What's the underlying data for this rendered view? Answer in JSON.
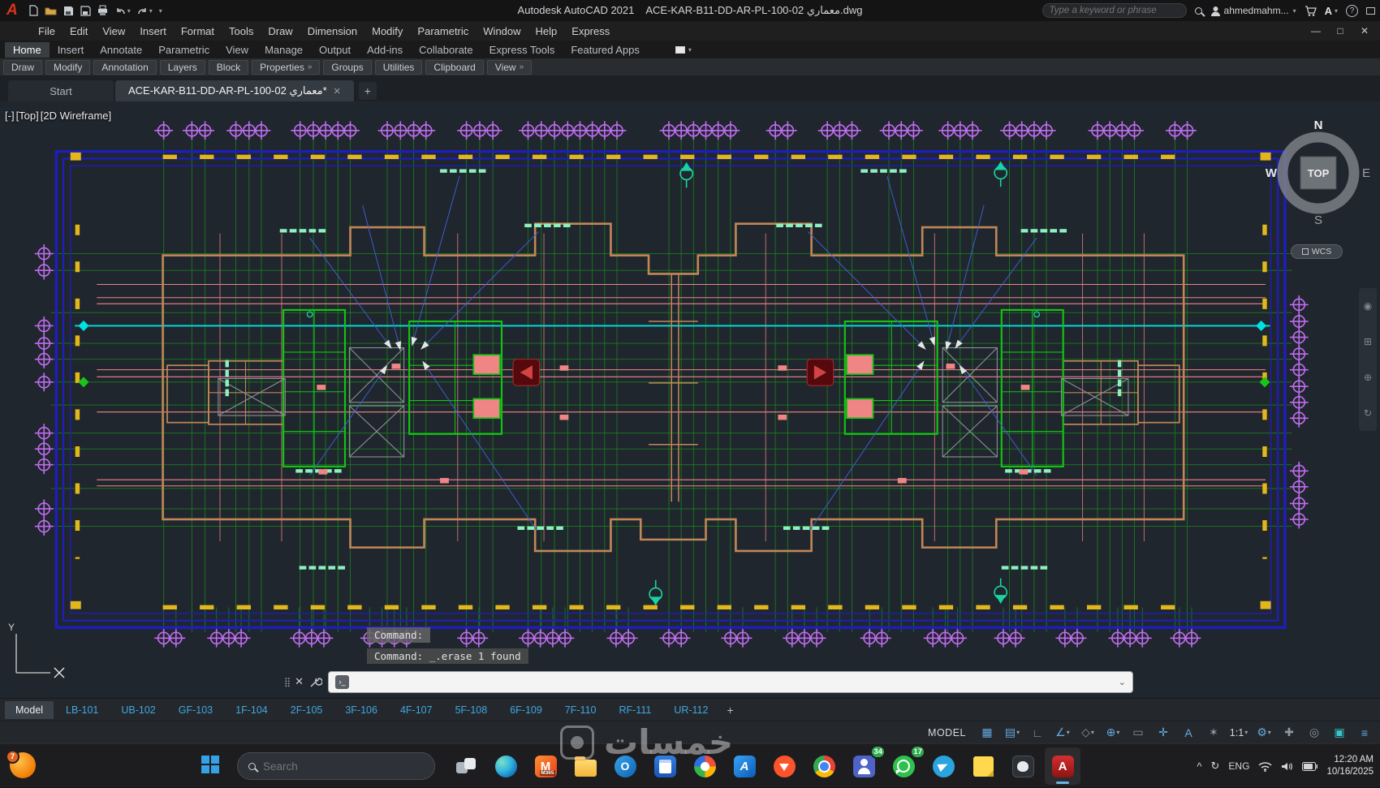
{
  "colors": {
    "accent_blue": "#2f9ade",
    "autocad_red": "#c4161c",
    "grid_green": "#188c18",
    "wall_tan": "#c08757",
    "bubble_purple": "#c06cf0",
    "datum_cyan": "#00e2e2",
    "salmon_pink": "#ee8585",
    "border_navy": "#1d1dc4",
    "border_yellow": "#e2b71c",
    "mint": "#8df0c0",
    "teal_marker": "#19d3a2"
  },
  "titlebar": {
    "app_title": "Autodesk AutoCAD 2021",
    "doc_title": "ACE-KAR-B11-DD-AR-PL-100-02 معماري.dwg",
    "search_placeholder": "Type a keyword or phrase",
    "user_name": "ahmedmahm...",
    "caret_glyph": "▾",
    "qat_icons": [
      "application-menu",
      "new-file",
      "open-file",
      "save",
      "save-as",
      "plot",
      "undo",
      "redo",
      "customize-qat"
    ]
  },
  "menubar": {
    "items": [
      "File",
      "Edit",
      "View",
      "Insert",
      "Format",
      "Tools",
      "Draw",
      "Dimension",
      "Modify",
      "Parametric",
      "Window",
      "Help",
      "Express"
    ],
    "window_controls": [
      "—",
      "□",
      "✕"
    ]
  },
  "ribbon": {
    "tabs": [
      "Home",
      "Insert",
      "Annotate",
      "Parametric",
      "View",
      "Manage",
      "Output",
      "Add-ins",
      "Collaborate",
      "Express Tools",
      "Featured Apps"
    ],
    "active_tab": "Home",
    "collapse_caret": "▾",
    "panels": [
      {
        "label": "Draw"
      },
      {
        "label": "Modify"
      },
      {
        "label": "Annotation"
      },
      {
        "label": "Layers"
      },
      {
        "label": "Block"
      },
      {
        "label": "Properties",
        "flyout": "»"
      },
      {
        "label": "Groups"
      },
      {
        "label": "Utilities"
      },
      {
        "label": "Clipboard"
      },
      {
        "label": "View",
        "flyout": "»"
      }
    ]
  },
  "file_tabs": {
    "start_label": "Start",
    "doc_label": "ACE-KAR-B11-DD-AR-PL-100-02 معماري*",
    "close_glyph": "✕",
    "add_glyph": "+"
  },
  "viewport": {
    "controls": [
      "[-]",
      "[Top]",
      "[2D Wireframe]"
    ],
    "navcube": {
      "n": "N",
      "e": "E",
      "s": "S",
      "w": "W",
      "top": "TOP"
    },
    "wcs_label": "WCS",
    "ucs_y_label": "Y"
  },
  "command_line": {
    "history_lines": [
      "Command:",
      "Command: _.erase 1 found"
    ],
    "close_glyph": "✕",
    "input_value": ""
  },
  "layout_bar": {
    "model_label": "Model",
    "tabs": [
      "LB-101",
      "UB-102",
      "GF-103",
      "1F-104",
      "2F-105",
      "3F-106",
      "4F-107",
      "5F-108",
      "6F-109",
      "7F-110",
      "RF-111",
      "UR-112"
    ],
    "add_glyph": "+"
  },
  "statusbar": {
    "model_label": "MODEL",
    "icons": [
      {
        "name": "grid-display",
        "glyph": "▦"
      },
      {
        "name": "snap-mode",
        "glyph": "▤",
        "caret": "▾"
      },
      {
        "name": "ortho-mode",
        "glyph": "∟"
      },
      {
        "name": "polar-tracking",
        "glyph": "∠",
        "caret": "▾"
      },
      {
        "name": "isometric-drafting",
        "glyph": "◇",
        "caret": "▾"
      },
      {
        "name": "object-snap",
        "glyph": "⊕",
        "caret": "▾"
      },
      {
        "name": "lineweight-display",
        "glyph": "▭"
      },
      {
        "name": "selection-cycling",
        "glyph": "✛"
      },
      {
        "name": "annotation-visibility",
        "glyph": "A"
      },
      {
        "name": "annotation-autoscale",
        "glyph": "✶"
      },
      {
        "name": "annotation-scale",
        "glyph": "1:1",
        "caret": "▾"
      },
      {
        "name": "workspace-switching",
        "glyph": "⚙",
        "caret": "▾"
      },
      {
        "name": "annotation-monitor",
        "glyph": "✚"
      },
      {
        "name": "isolate-objects",
        "glyph": "◎"
      },
      {
        "name": "clean-screen",
        "glyph": "▣"
      },
      {
        "name": "customize",
        "glyph": "≡"
      }
    ]
  },
  "taskbar": {
    "widget_badge": "7",
    "search_placeholder": "Search",
    "apps": [
      {
        "name": "task-view"
      },
      {
        "name": "edge-browser"
      },
      {
        "name": "microsoft-365",
        "label": "M365"
      },
      {
        "name": "file-explorer"
      },
      {
        "name": "outlook"
      },
      {
        "name": "calendar-app"
      },
      {
        "name": "photos-app"
      },
      {
        "name": "azure-portal"
      },
      {
        "name": "brave-browser"
      },
      {
        "name": "chrome-browser"
      },
      {
        "name": "teams",
        "badge": "34"
      },
      {
        "name": "whatsapp",
        "badge": "17"
      },
      {
        "name": "telegram"
      },
      {
        "name": "sticky-notes"
      },
      {
        "name": "github-desktop"
      },
      {
        "name": "autocad",
        "active": true
      }
    ],
    "tray": {
      "expand_glyph": "^",
      "sync_glyph": "↻",
      "language": "ENG",
      "time": "12:20 AM",
      "date": "10/16/2025"
    }
  },
  "watermark": {
    "text": "خمسات"
  }
}
